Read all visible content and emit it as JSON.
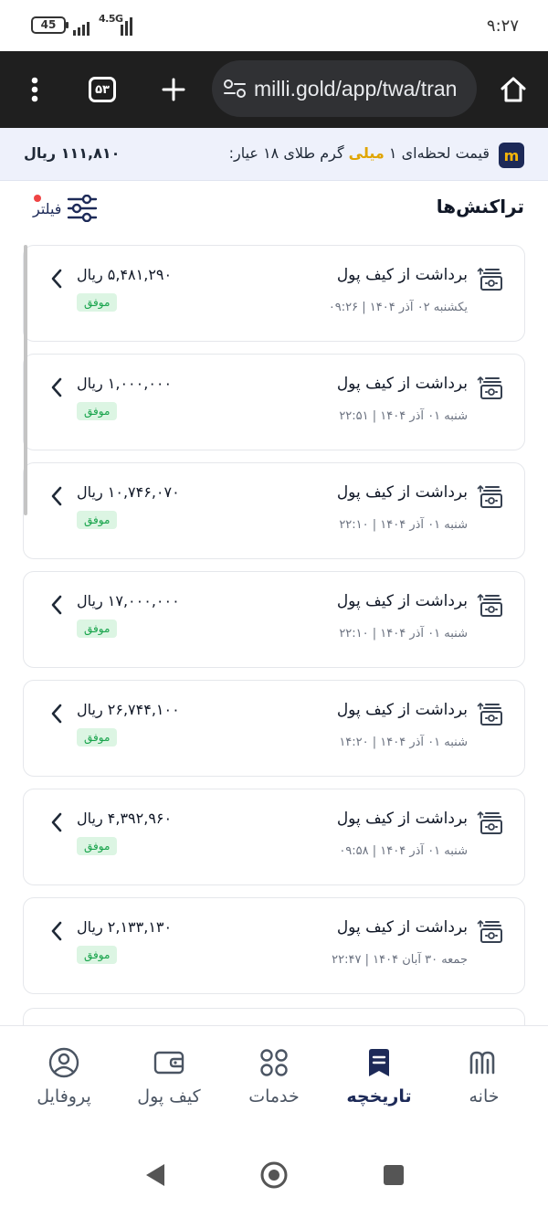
{
  "status_bar": {
    "time": "۹:۲۷",
    "battery": "45",
    "network": "4.5G"
  },
  "browser": {
    "url": "milli.gold/app/twa/tran",
    "tab_count": "۵۳",
    "icons": [
      "home-icon",
      "site-settings-icon",
      "new-tab-icon",
      "tabs-icon",
      "menu-icon"
    ]
  },
  "ticker": {
    "text_before": "قیمت لحظه‌ای ۱ ",
    "highlight": "میلی",
    "text_after": " گرم طلای ۱۸ عیار:",
    "price": "۱۱۱,۸۱۰ ریال",
    "logo_letter": "m",
    "colors": {
      "highlight": "#e0a500",
      "logo_bg": "#1d2a58"
    }
  },
  "page": {
    "title": "تراکنش‌ها",
    "filter_label": "فیلتر"
  },
  "transactions": [
    {
      "type": "برداشت از کیف پول",
      "date": "یکشنبه ۰۲ آذر ۱۴۰۴ | ۰۹:۲۶",
      "amount": "۵,۴۸۱,۲۹۰ ریال",
      "status": "موفق"
    },
    {
      "type": "برداشت از کیف پول",
      "date": "شنبه ۰۱ آذر ۱۴۰۴ | ۲۲:۵۱",
      "amount": "۱,۰۰۰,۰۰۰ ریال",
      "status": "موفق"
    },
    {
      "type": "برداشت از کیف پول",
      "date": "شنبه ۰۱ آذر ۱۴۰۴ | ۲۲:۱۰",
      "amount": "۱۰,۷۴۶,۰۷۰ ریال",
      "status": "موفق"
    },
    {
      "type": "برداشت از کیف پول",
      "date": "شنبه ۰۱ آذر ۱۴۰۴ | ۲۲:۱۰",
      "amount": "۱۷,۰۰۰,۰۰۰ ریال",
      "status": "موفق"
    },
    {
      "type": "برداشت از کیف پول",
      "date": "شنبه ۰۱ آذر ۱۴۰۴ | ۱۴:۲۰",
      "amount": "۲۶,۷۴۴,۱۰۰ ریال",
      "status": "موفق"
    },
    {
      "type": "برداشت از کیف پول",
      "date": "شنبه ۰۱ آذر ۱۴۰۴ | ۰۹:۵۸",
      "amount": "۴,۳۹۲,۹۶۰ ریال",
      "status": "موفق"
    },
    {
      "type": "برداشت از کیف پول",
      "date": "جمعه ۳۰ آبان ۱۴۰۴ | ۲۲:۴۷",
      "amount": "۲,۱۳۳,۱۳۰ ریال",
      "status": "موفق"
    }
  ],
  "bottom_nav": [
    {
      "label": "خانه",
      "icon": "home-logo-icon"
    },
    {
      "label": "تاریخچه",
      "icon": "history-icon",
      "active": true
    },
    {
      "label": "خدمات",
      "icon": "services-grid-icon"
    },
    {
      "label": "کیف پول",
      "icon": "wallet-icon"
    },
    {
      "label": "پروفایل",
      "icon": "profile-icon"
    }
  ],
  "android_nav": [
    "back-icon",
    "home-circle-icon",
    "recents-icon"
  ]
}
